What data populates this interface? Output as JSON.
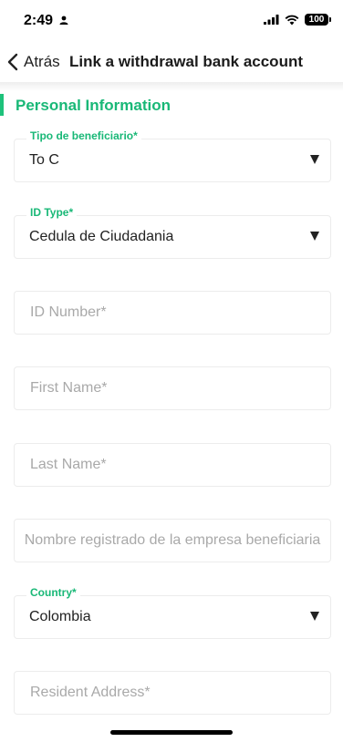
{
  "status_bar": {
    "time": "2:49",
    "battery": "100"
  },
  "nav": {
    "back_label": "Atrás",
    "title": "Link a withdrawal bank account"
  },
  "section": {
    "title": "Personal Information"
  },
  "fields": {
    "beneficiary_type": {
      "label": "Tipo de beneficiario",
      "value": "To C"
    },
    "id_type": {
      "label": "ID Type",
      "value": "Cedula de Ciudadania"
    },
    "id_number": {
      "placeholder": "ID Number*"
    },
    "first_name": {
      "placeholder": "First Name*"
    },
    "last_name": {
      "placeholder": "Last Name*"
    },
    "company_name": {
      "placeholder": "Nombre registrado de la empresa beneficiaria"
    },
    "country": {
      "label": "Country",
      "value": "Colombia"
    },
    "resident_address": {
      "placeholder": "Resident Address*"
    }
  },
  "colors": {
    "accent": "#19b877",
    "border": "#ececec",
    "placeholder": "#a9a9a9"
  }
}
